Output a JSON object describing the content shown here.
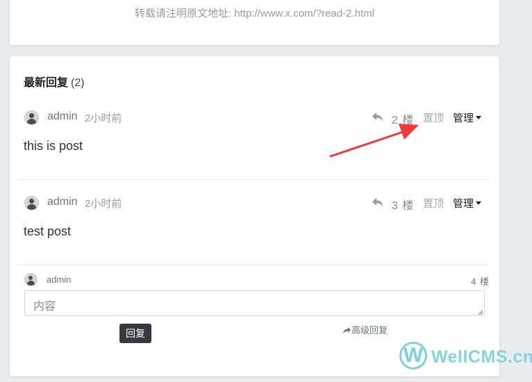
{
  "source_line": "转载请注明原文地址: http://www.x.com/?read-2.html",
  "replies_section": {
    "title": "最新回复",
    "count": "(2)"
  },
  "posts": [
    {
      "user": "admin",
      "time": "2小时前",
      "floor": "2 楼",
      "pin_label": "置顶",
      "manage_label": "管理",
      "content": "this is post"
    },
    {
      "user": "admin",
      "time": "2小时前",
      "floor": "3 楼",
      "pin_label": "置顶",
      "manage_label": "管理",
      "content": "test post"
    }
  ],
  "reply_form": {
    "user": "admin",
    "floor": "4 楼",
    "placeholder": "内容",
    "submit_label": "回复",
    "advanced_label": "高级回复"
  },
  "watermark": {
    "logo_letter": "W",
    "text": "WellCMS.cn"
  },
  "colors": {
    "annotation_arrow": "#f03a3a",
    "submit_bg": "#343a40",
    "watermark": "#7fd0d8"
  },
  "icons": [
    "reply-icon",
    "caret-down-icon",
    "avatar-icon",
    "share-icon",
    "red-arrow-annotation"
  ]
}
